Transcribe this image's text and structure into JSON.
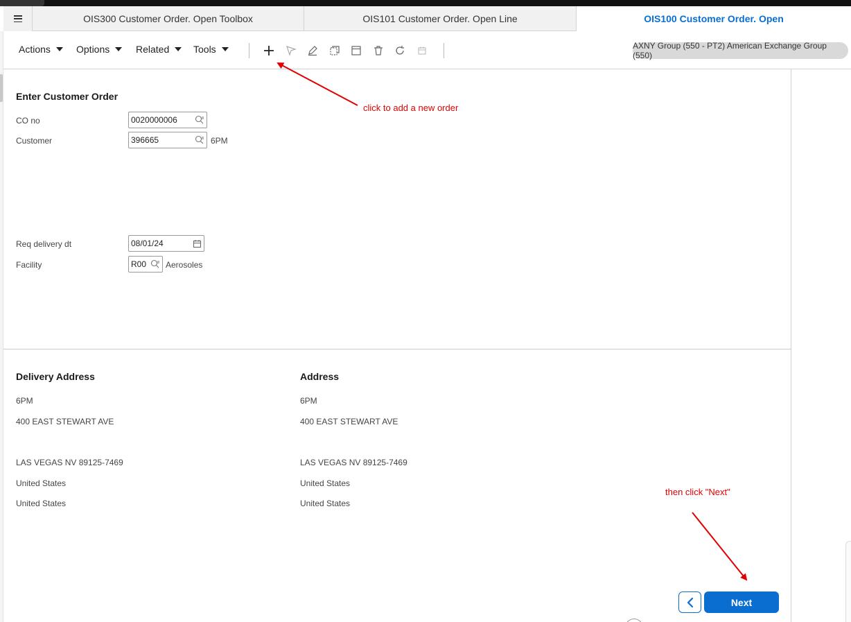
{
  "tabs": [
    {
      "label": "OIS300 Customer Order. Open Toolbox",
      "active": false
    },
    {
      "label": "OIS101 Customer Order. Open Line",
      "active": false
    },
    {
      "label": "OIS100 Customer Order. Open",
      "active": true
    }
  ],
  "toolbar": {
    "menus": [
      "Actions",
      "Options",
      "Related",
      "Tools"
    ],
    "icons": [
      "plus-icon",
      "select-icon",
      "edit-icon",
      "copy-icon",
      "display-icon",
      "delete-icon",
      "refresh-icon",
      "calendar-icon"
    ],
    "context": "AXNY Group (550 - PT2) American Exchange Group (550)"
  },
  "form": {
    "title": "Enter Customer Order",
    "co_no": {
      "label": "CO no",
      "value": "0020000006"
    },
    "customer": {
      "label": "Customer",
      "value": "396665",
      "description": "6PM"
    },
    "req_delivery": {
      "label": "Req delivery dt",
      "value": "08/01/24"
    },
    "facility": {
      "label": "Facility",
      "value": "R00",
      "description": "Aerosoles"
    }
  },
  "delivery_address": {
    "title": "Delivery Address",
    "lines": [
      "6PM",
      "400 EAST STEWART AVE",
      "LAS VEGAS NV 89125-7469",
      "United States",
      "United States"
    ]
  },
  "address": {
    "title": "Address",
    "lines": [
      "6PM",
      "400 EAST STEWART AVE",
      "LAS VEGAS NV 89125-7469",
      "United States",
      "United States"
    ]
  },
  "annotations": {
    "add_order": "click to add a new order",
    "next": "then click \"Next\""
  },
  "buttons": {
    "next": "Next"
  },
  "colors": {
    "accent": "#0a6ed1",
    "annotation": "#e00000"
  }
}
